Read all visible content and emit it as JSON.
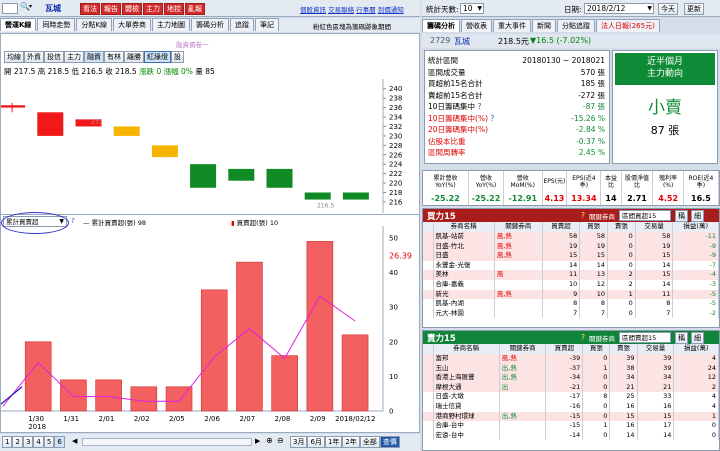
{
  "stock_bar": {
    "code": "",
    "name": "瓦城",
    "red_buttons": [
      "看法",
      "報告",
      "體檢",
      "主力",
      "地控",
      "亂報"
    ],
    "links": [
      "個股資訊",
      "交易聯絡",
      "行事曆",
      "到價通知"
    ]
  },
  "right_top": {
    "freq_label": "統計天數:",
    "freq_value": "10",
    "date_label": "日期:",
    "date_value": "2018/2/12",
    "today_btn": "今天",
    "refresh_btn": "更新"
  },
  "left_tabs": [
    "營運K線",
    "同時走勢",
    "分點K線",
    "大單券商",
    "主力地圖",
    "籌碼分析",
    "追蹤",
    "筆記"
  ],
  "header_note": "粉紅色區塊為籌碼跡象期間",
  "chart_toolbar": {
    "buttons": [
      "均線",
      "外資",
      "投信",
      "主力",
      "融資",
      "有林",
      "離勝",
      "紅綠燈",
      "設"
    ],
    "active": "紅綠燈",
    "title": "融資債卷一"
  },
  "ohlc": {
    "open_label": "開",
    "open": "217.5",
    "high_label": "高",
    "high": "218.5",
    "low_label": "低",
    "low": "216.5",
    "close_label": "收",
    "close": "218.5",
    "up_label": "漲跌",
    "up": "0",
    "pct_label": "漲幅",
    "pct": "0%",
    "vol_label": "量",
    "vol": "85"
  },
  "chart_data": [
    {
      "type": "candlestick",
      "y_ticks": [
        240,
        238,
        236,
        234,
        232,
        230,
        228,
        226,
        224,
        222,
        220,
        218,
        216
      ],
      "ylim": [
        214.5,
        241
      ],
      "annotations": [
        "233",
        "216.5"
      ],
      "candles": [
        {
          "open": 236,
          "close": 236.5,
          "high": 237,
          "low": 235,
          "color": "red"
        },
        {
          "open": 230,
          "close": 235,
          "high": 235,
          "low": 230,
          "color": "red"
        },
        {
          "open": 232,
          "close": 233.5,
          "high": 233.5,
          "low": 232,
          "color": "red"
        },
        {
          "open": 232,
          "close": 230,
          "high": 232,
          "low": 230,
          "color": "yellow"
        },
        {
          "open": 228,
          "close": 225.5,
          "high": 228,
          "low": 225.5,
          "color": "yellow"
        },
        {
          "open": 224,
          "close": 219,
          "high": 224,
          "low": 219,
          "color": "green"
        },
        {
          "open": 223,
          "close": 220.5,
          "high": 223,
          "low": 220.5,
          "color": "green"
        },
        {
          "open": 223,
          "close": 219,
          "high": 223,
          "low": 219,
          "color": "green"
        },
        {
          "open": 218,
          "close": 216.5,
          "high": 218,
          "low": 216.5,
          "color": "green"
        },
        {
          "open": 218,
          "close": 216.5,
          "high": 218,
          "low": 216.5,
          "color": "green"
        }
      ]
    },
    {
      "type": "bar",
      "series": [
        {
          "name": "累計買賣超(張)",
          "values": [
            0,
            20,
            9,
            9,
            7,
            7,
            35,
            43,
            16,
            49,
            22
          ]
        },
        {
          "name": "買賣超(張)",
          "values": [
            1,
            10,
            3,
            3,
            2,
            2,
            6,
            11,
            4,
            16,
            10
          ]
        }
      ],
      "categories": [
        "1/30",
        "1/31",
        "2/01",
        "2/02",
        "2/05",
        "2/06",
        "2/07",
        "2/08",
        "2/09",
        "2/12"
      ],
      "y_ticks": [
        50,
        40,
        30,
        20,
        10,
        0
      ],
      "ylim": [
        0,
        52
      ],
      "value_label": "26.39"
    }
  ],
  "lower_panel": {
    "select": "累計買賣超",
    "legend1_label": "累計買賣超(張)",
    "legend1_value": "98",
    "legend2_label": "買賣超(張)",
    "legend2_value": "10",
    "x_labels": [
      "1/30",
      "1/31",
      "2/01",
      "2/02",
      "2/05",
      "2/06",
      "2/07",
      "2/08",
      "2/09",
      "2018/02/12"
    ],
    "year": "2018"
  },
  "bottom": {
    "pages": [
      "1",
      "2",
      "3",
      "4",
      "5",
      "6"
    ],
    "ranges": [
      "3月",
      "6月",
      "1年",
      "2年",
      "全部",
      "查價"
    ]
  },
  "right_tabs": [
    "籌碼分析",
    "營收表",
    "重大事件",
    "新聞",
    "分點追蹤",
    "法人日報(265元)"
  ],
  "stock_head": {
    "code": "2729",
    "name": "瓦城",
    "price": "218.5元",
    "chg": "▼16.5 (-7.02%)"
  },
  "stats": [
    {
      "label": "統計區間",
      "value": "20180130 ~ 2018021"
    },
    {
      "label": "區間成交量",
      "value": "570 張"
    },
    {
      "label": "買超前15名合計",
      "value": "185 張"
    },
    {
      "label": "賣超前15名合計",
      "value": "-272 張"
    },
    {
      "label": "10日籌碼集中",
      "value": "-87 張"
    },
    {
      "label": "10日籌碼集中(%)",
      "value": "-15.26 %"
    },
    {
      "label": "20日籌碼集中(%)",
      "value": "-2.84 %"
    },
    {
      "label": "佔股本比重",
      "value": "-0.37 %"
    },
    {
      "label": "區間周轉率",
      "value": "2.45 %"
    }
  ],
  "sentiment": {
    "title1": "近半個月",
    "title2": "主力動向",
    "verdict": "小賣",
    "amount": "87 張"
  },
  "metrics": {
    "headers": [
      "累計營收YoY(%)",
      "營收YoY(%)",
      "營收MoM(%)",
      "EPS(元)",
      "EPS(近4季)",
      "本益比",
      "股價淨值比",
      "殖利率(%)",
      "ROE(近4季)"
    ],
    "values": [
      "-25.22",
      "-25.22",
      "-12.91",
      "4.13",
      "13.34",
      "14",
      "2.71",
      "4.52",
      "16.5"
    ]
  },
  "buy15": {
    "title": "買力15",
    "filter_label": "關鍵券商",
    "select": "區間買超15",
    "btn1": "稱",
    "btn2": "細",
    "headers": [
      "",
      "券商名稱",
      "關鍵券商",
      "買賣超",
      "買張",
      "賣張",
      "交易量",
      "損益(萬)"
    ],
    "rows": [
      [
        "",
        "凱基-站前",
        "風,熱",
        "58",
        "58",
        "0",
        "58",
        "-11"
      ],
      [
        "",
        "日盛-竹北",
        "風,熱",
        "19",
        "19",
        "0",
        "19",
        "-9"
      ],
      [
        "",
        "日盛",
        "風,熱",
        "15",
        "15",
        "0",
        "15",
        "-9"
      ],
      [
        "",
        "永豐金-光復",
        "",
        "14",
        "14",
        "0",
        "14",
        "-7"
      ],
      [
        "",
        "美林",
        "風",
        "11",
        "13",
        "2",
        "15",
        "-4"
      ],
      [
        "",
        "合庫-嘉義",
        "",
        "10",
        "12",
        "2",
        "14",
        "-3"
      ],
      [
        "",
        "新光",
        "風,熱",
        "9",
        "10",
        "1",
        "11",
        "-5"
      ],
      [
        "",
        "凱基-內湖",
        "",
        "8",
        "8",
        "0",
        "8",
        "-5"
      ],
      [
        "",
        "元大-林園",
        "",
        "7",
        "7",
        "0",
        "7",
        "-2"
      ]
    ]
  },
  "sell15": {
    "title": "賣力15",
    "filter_label": "關鍵券商",
    "select": "區間賣超15",
    "btn1": "稱",
    "btn2": "細",
    "headers": [
      "",
      "券商名稱",
      "關鍵券商",
      "買賣超",
      "買張",
      "賣張",
      "交易量",
      "損益(萬)"
    ],
    "rows": [
      [
        "",
        "富邦",
        "風,熱",
        "-39",
        "0",
        "39",
        "39",
        "4"
      ],
      [
        "",
        "玉山",
        "出,熱",
        "-37",
        "1",
        "38",
        "39",
        "24"
      ],
      [
        "",
        "香港上海匯豐",
        "出,熱",
        "-34",
        "0",
        "34",
        "34",
        "12"
      ],
      [
        "",
        "摩根大通",
        "出",
        "-21",
        "0",
        "21",
        "21",
        "2"
      ],
      [
        "",
        "日盛-大墩",
        "",
        "-17",
        "8",
        "25",
        "33",
        "4"
      ],
      [
        "",
        "瑞士信貸",
        "",
        "-16",
        "0",
        "16",
        "16",
        "4"
      ],
      [
        "",
        "港商野村環球",
        "出,熱",
        "-15",
        "0",
        "15",
        "15",
        "1"
      ],
      [
        "",
        "合庫-台中",
        "",
        "-15",
        "1",
        "16",
        "17",
        "0"
      ],
      [
        "",
        "宏遠-台中",
        "",
        "-14",
        "0",
        "14",
        "14",
        "0"
      ]
    ]
  }
}
